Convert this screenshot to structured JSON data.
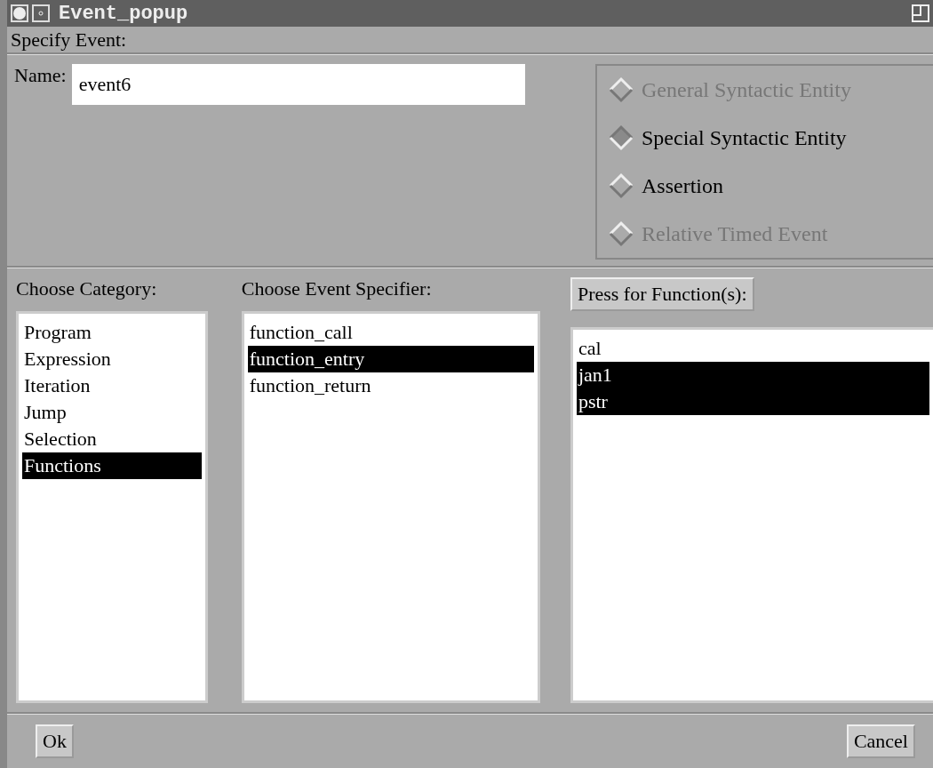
{
  "window": {
    "title": "Event_popup"
  },
  "section_title": "Specify Event:",
  "name_field": {
    "label": "Name:",
    "value": "event6"
  },
  "event_types": [
    {
      "label": "General Syntactic Entity",
      "selected": false,
      "disabled": true
    },
    {
      "label": "Special Syntactic Entity",
      "selected": true,
      "disabled": false
    },
    {
      "label": "Assertion",
      "selected": false,
      "disabled": false
    },
    {
      "label": "Relative Timed Event",
      "selected": false,
      "disabled": true
    }
  ],
  "category": {
    "label": "Choose Category:",
    "items": [
      {
        "label": "Program",
        "selected": false
      },
      {
        "label": "Expression",
        "selected": false
      },
      {
        "label": "Iteration",
        "selected": false
      },
      {
        "label": "Jump",
        "selected": false
      },
      {
        "label": "Selection",
        "selected": false
      },
      {
        "label": "Functions",
        "selected": true
      }
    ]
  },
  "specifier": {
    "label": "Choose Event Specifier:",
    "items": [
      {
        "label": "function_call",
        "selected": false
      },
      {
        "label": "function_entry",
        "selected": true
      },
      {
        "label": "function_return",
        "selected": false
      }
    ]
  },
  "functions": {
    "button": "Press for Function(s):",
    "items": [
      {
        "label": "cal",
        "selected": false
      },
      {
        "label": "jan1",
        "selected": true
      },
      {
        "label": "pstr",
        "selected": true
      }
    ]
  },
  "buttons": {
    "ok": "Ok",
    "cancel": "Cancel"
  }
}
